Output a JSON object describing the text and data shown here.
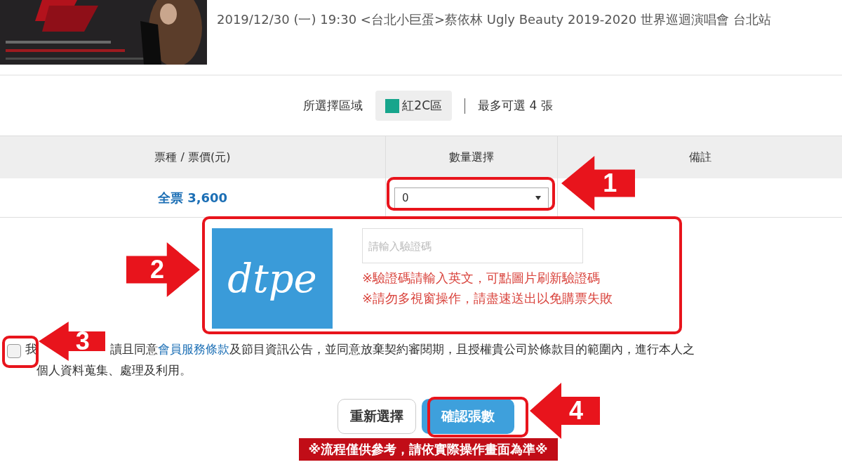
{
  "event": {
    "title": "2019/12/30 (一) 19:30 <台北小巨蛋>蔡依林 Ugly Beauty 2019-2020 世界巡迴演唱會 台北站"
  },
  "area": {
    "label": "所選擇區域",
    "zone": "紅2C區",
    "color": "#17a58c",
    "limit": "最多可選 4 張"
  },
  "table": {
    "columns": [
      "票種 / 票價(元)",
      "數量選擇",
      "備註"
    ],
    "rows": [
      {
        "ticket": "全票 3,600",
        "quantity": "0"
      }
    ]
  },
  "captcha": {
    "image_text": "dtpe",
    "placeholder": "請輸入驗證碼",
    "notes": [
      "※驗證碼請輸入英文，可點圖片刷新驗證碼",
      "※請勿多視窗操作，請盡速送出以免購票失敗"
    ]
  },
  "agreement": {
    "checked": false,
    "lead": "我",
    "text": "讀且同意",
    "link": "會員服務條款",
    "rest": "及節目資訊公告，並同意放棄契約審閱期，且授權貴公司於條款目的範圍內，進行本人之",
    "line2": "個人資料蒐集、處理及利用。"
  },
  "buttons": [
    {
      "label": "重新選擇",
      "kind": "secondary"
    },
    {
      "label": "確認張數",
      "kind": "primary"
    }
  ],
  "disclaimer": "※流程僅供參考，請依實際操作畫面為準※",
  "callouts": [
    {
      "number": "1"
    },
    {
      "number": "2"
    },
    {
      "number": "3"
    },
    {
      "number": "4"
    }
  ]
}
